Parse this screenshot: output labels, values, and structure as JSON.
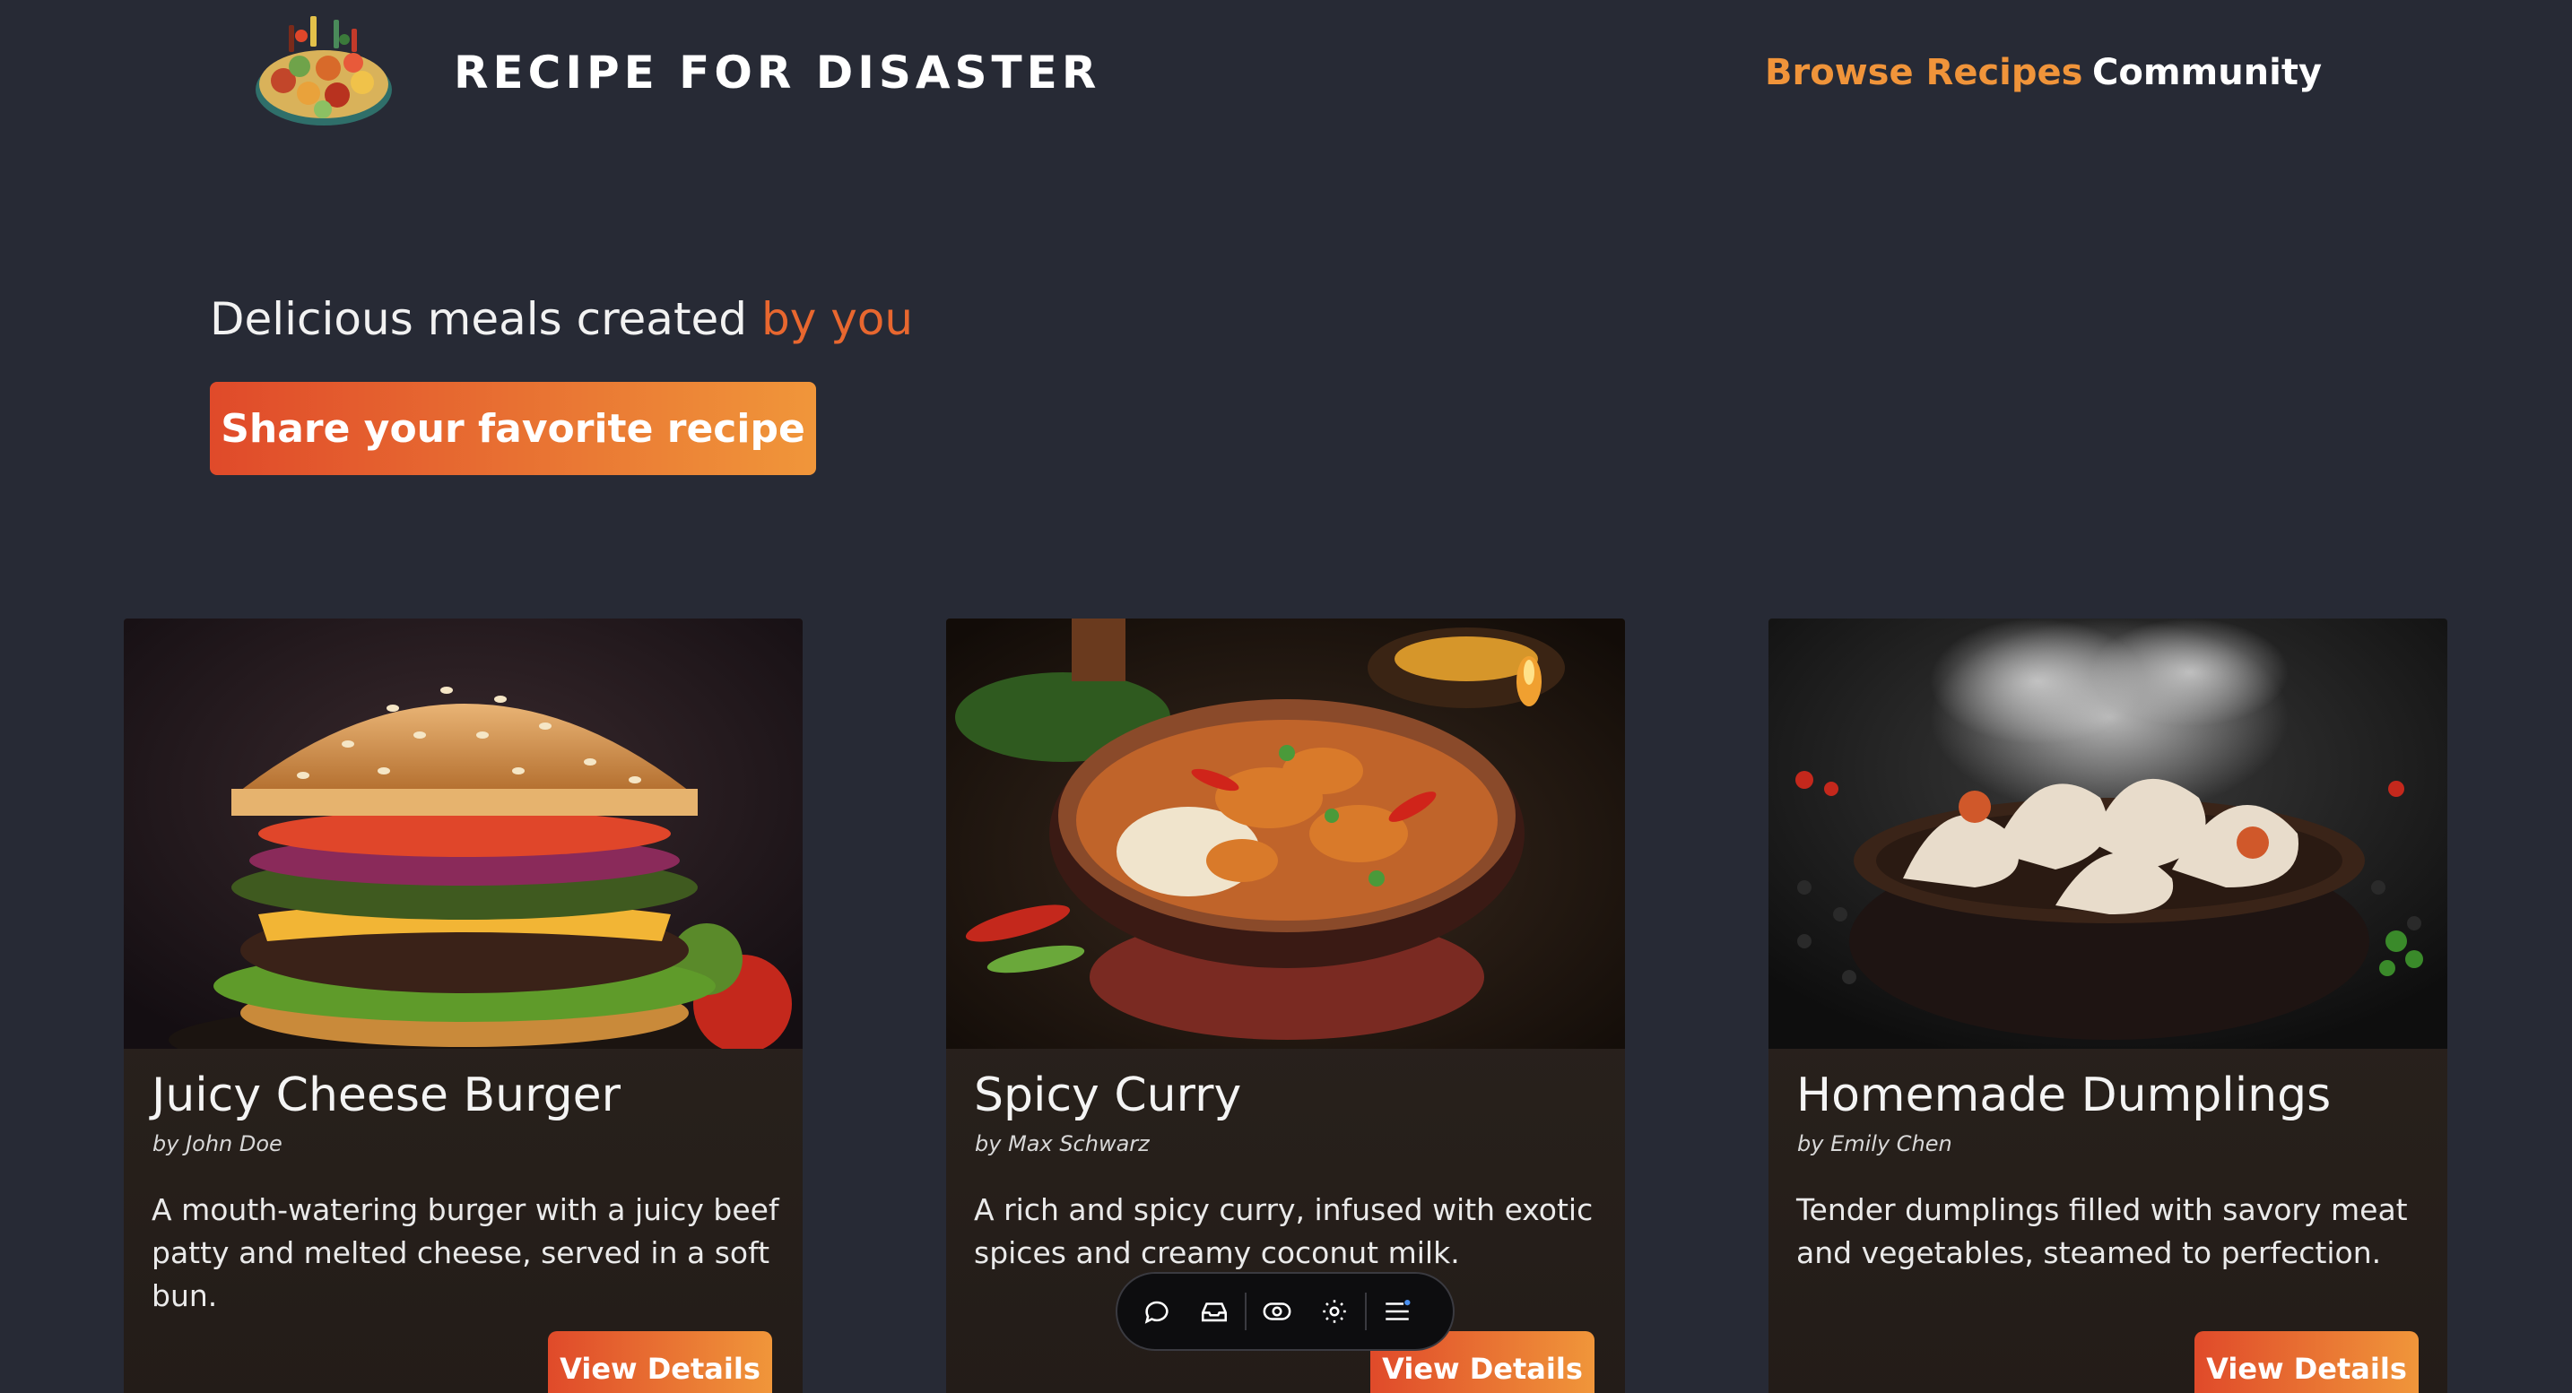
{
  "header": {
    "site_title": "RECIPE FOR DISASTER",
    "logo_icon": "food-platter-logo",
    "nav": [
      {
        "label": "Browse Recipes",
        "active": true,
        "color": "#f0943a"
      },
      {
        "label": "Community",
        "active": false,
        "color": "#ffffff"
      }
    ]
  },
  "hero": {
    "tagline_main": "Delicious meals created",
    "tagline_accent": "by you",
    "share_button": "Share your favorite recipe"
  },
  "recipes": [
    {
      "title": "Juicy Cheese Burger",
      "author": "by John Doe",
      "description": "A mouth-watering burger with a juicy beef patty and melted cheese, served in a soft bun.",
      "button": "View Details",
      "image": "cheeseburger-photo"
    },
    {
      "title": "Spicy Curry",
      "author": "by Max Schwarz",
      "description": "A rich and spicy curry, infused with exotic spices and creamy coconut milk.",
      "button": "View Details",
      "image": "curry-photo"
    },
    {
      "title": "Homemade Dumplings",
      "author": "by Emily Chen",
      "description": "Tender dumplings filled with savory meat and vegetables, steamed to perfection.",
      "button": "View Details",
      "image": "dumplings-photo"
    }
  ],
  "toolbar": {
    "icons": [
      "comment-icon",
      "inbox-icon",
      "eye-icon",
      "settings-icon",
      "menu-icon"
    ]
  },
  "colors": {
    "background": "#272a35",
    "accent_orange": "#f0943a",
    "accent_red": "#e04a2a"
  }
}
